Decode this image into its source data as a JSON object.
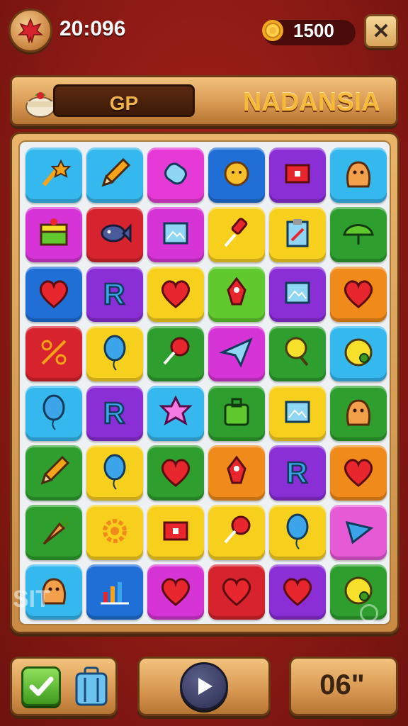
{
  "hud": {
    "timer": "20:096",
    "coins": "1500",
    "close_symbol": "✕"
  },
  "header": {
    "slot_label": "GP",
    "title": "NADANSIA"
  },
  "board": {
    "rows": [
      [
        {
          "color": "#35b8ee",
          "icon": "wand-icon"
        },
        {
          "color": "#35b8ee",
          "icon": "pencil-icon"
        },
        {
          "color": "#e63ad6",
          "icon": "roll-icon"
        },
        {
          "color": "#1f6fd6",
          "icon": "sun-face-icon"
        },
        {
          "color": "#8a2ed6",
          "icon": "photo-icon"
        },
        {
          "color": "#35b8ee",
          "icon": "blob-icon"
        }
      ],
      [
        {
          "color": "#d634d6",
          "icon": "cake-icon"
        },
        {
          "color": "#d6232d",
          "icon": "fish-icon"
        },
        {
          "color": "#d634d6",
          "icon": "picture-icon"
        },
        {
          "color": "#f7d01e",
          "icon": "paintbrush-icon"
        },
        {
          "color": "#f7d01e",
          "icon": "clipboard-icon"
        },
        {
          "color": "#2e9e2e",
          "icon": "leaf-icon"
        }
      ],
      [
        {
          "color": "#1f6fd6",
          "icon": "heart-icon"
        },
        {
          "color": "#8a2ed6",
          "icon": "letter-r-icon"
        },
        {
          "color": "#f7d01e",
          "icon": "heart-icon"
        },
        {
          "color": "#5fc92e",
          "icon": "rocket-icon"
        },
        {
          "color": "#8a2ed6",
          "icon": "picture-icon"
        },
        {
          "color": "#f08a1a",
          "icon": "heart-icon"
        }
      ],
      [
        {
          "color": "#d6232d",
          "icon": "percent-icon"
        },
        {
          "color": "#f7d01e",
          "icon": "balloon-icon"
        },
        {
          "color": "#2e9e2e",
          "icon": "lollipop-icon"
        },
        {
          "color": "#d634d6",
          "icon": "paper-plane-icon"
        },
        {
          "color": "#2e9e2e",
          "icon": "ping-pong-icon"
        },
        {
          "color": "#35b8ee",
          "icon": "letter-c-icon"
        }
      ],
      [
        {
          "color": "#35b8ee",
          "icon": "balloon-icon"
        },
        {
          "color": "#8a2ed6",
          "icon": "letter-r-icon"
        },
        {
          "color": "#35b8ee",
          "icon": "star-blob-icon"
        },
        {
          "color": "#2e9e2e",
          "icon": "bag-icon"
        },
        {
          "color": "#f7d01e",
          "icon": "picture-icon"
        },
        {
          "color": "#2e9e2e",
          "icon": "blob-icon"
        }
      ],
      [
        {
          "color": "#2e9e2e",
          "icon": "pencil-icon"
        },
        {
          "color": "#f7d01e",
          "icon": "balloon-icon"
        },
        {
          "color": "#2e9e2e",
          "icon": "heart-icon"
        },
        {
          "color": "#f08a1a",
          "icon": "rocket-icon"
        },
        {
          "color": "#8a2ed6",
          "icon": "letter-r-icon"
        },
        {
          "color": "#f08a1a",
          "icon": "heart-icon"
        }
      ],
      [
        {
          "color": "#2e9e2e",
          "icon": "carrot-icon"
        },
        {
          "color": "#f7d01e",
          "icon": "gear-icon"
        },
        {
          "color": "#f7d01e",
          "icon": "photo-icon"
        },
        {
          "color": "#f7d01e",
          "icon": "lollipop-icon"
        },
        {
          "color": "#f7d01e",
          "icon": "balloon-icon"
        },
        {
          "color": "#e65ad6",
          "icon": "triangle-icon"
        }
      ],
      [
        {
          "color": "#35b8ee",
          "icon": "blob-icon"
        },
        {
          "color": "#1f6fd6",
          "icon": "bar-chart-icon"
        },
        {
          "color": "#d634d6",
          "icon": "heart-icon"
        },
        {
          "color": "#d6232d",
          "icon": "heart-icon"
        },
        {
          "color": "#8a2ed6",
          "icon": "heart-icon"
        },
        {
          "color": "#2e9e2e",
          "icon": "letter-c-icon"
        }
      ]
    ]
  },
  "watermark": "SIT",
  "footer": {
    "moves": "06\""
  }
}
